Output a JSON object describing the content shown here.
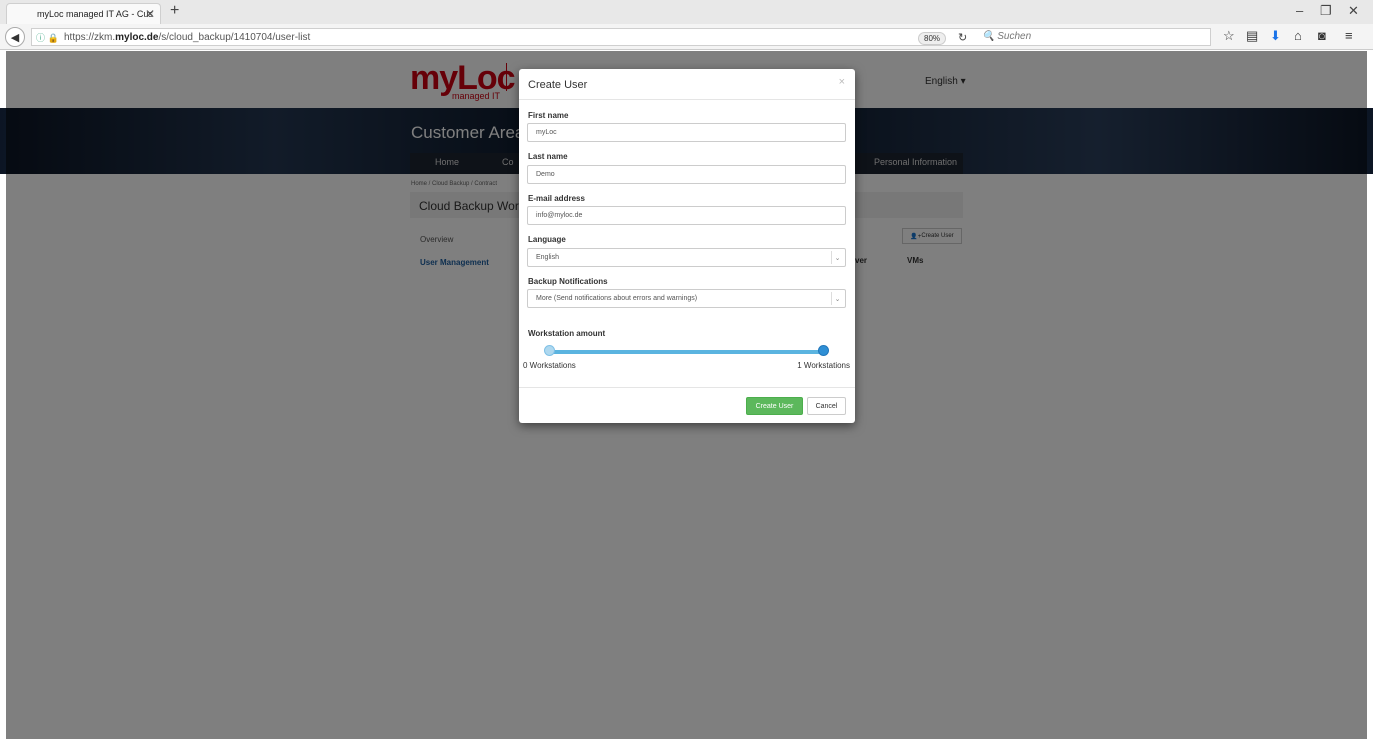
{
  "browser": {
    "tab_title": "myLoc managed IT AG - Cus",
    "url_prefix": "https://zkm.",
    "url_domain": "myloc.de",
    "url_path": "/s/cloud_backup/1410704/user-list",
    "zoom": "80%",
    "search_placeholder": "Suchen"
  },
  "page": {
    "logo_main": "myLoc",
    "logo_sub": "managed IT",
    "language": "English ▾",
    "banner_title": "Customer Area",
    "menu": [
      "Home",
      "Co",
      "Personal Information"
    ],
    "breadcrumb": "Home / Cloud Backup / Contract",
    "panel_title": "Cloud Backup Workst",
    "side_items": [
      "Overview",
      "User Management"
    ],
    "create_user_small": "Create User",
    "columns": [
      "ver",
      "VMs"
    ]
  },
  "modal": {
    "title": "Create User",
    "close": "×",
    "fields": {
      "first_name": {
        "label": "First name",
        "value": "myLoc"
      },
      "last_name": {
        "label": "Last name",
        "value": "Demo"
      },
      "email": {
        "label": "E-mail address",
        "value": "info@myloc.de"
      },
      "language": {
        "label": "Language",
        "value": "English"
      },
      "notifications": {
        "label": "Backup Notifications",
        "value": "More (Send notifications about errors and warnings)"
      }
    },
    "slider": {
      "label": "Workstation amount",
      "min_label": "0 Workstations",
      "max_label": "1 Workstations",
      "min_value": 0,
      "max_value": 1,
      "selected": 1
    },
    "create_button": "Create User",
    "cancel_button": "Cancel"
  },
  "colors": {
    "accent_green": "#5cb85c",
    "brand_red": "#cc1111",
    "slider_blue": "#5bb4e0"
  }
}
